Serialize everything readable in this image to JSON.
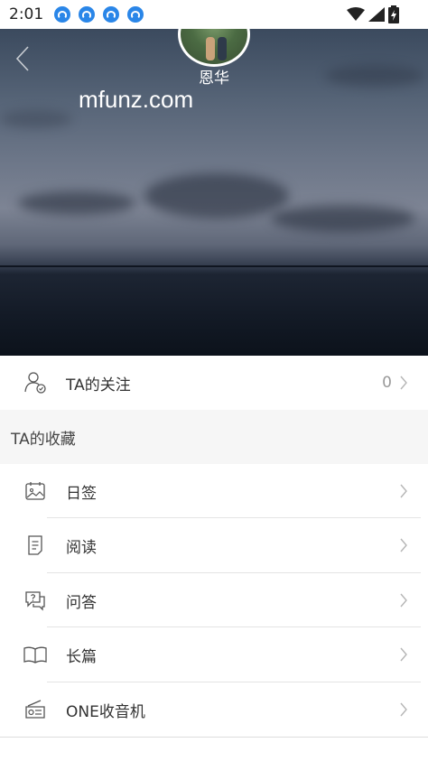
{
  "status_bar": {
    "time": "2:01"
  },
  "profile": {
    "username": "恩华",
    "watermark": "mfunz.com"
  },
  "following": {
    "label": "TA的关注",
    "count": "0"
  },
  "collections": {
    "header": "TA的收藏",
    "items": [
      {
        "label": "日签",
        "icon": "calendar-image-icon"
      },
      {
        "label": "阅读",
        "icon": "document-icon"
      },
      {
        "label": "问答",
        "icon": "question-bubble-icon"
      },
      {
        "label": "长篇",
        "icon": "open-book-icon"
      },
      {
        "label": "ONE收音机",
        "icon": "radio-icon"
      }
    ]
  },
  "colors": {
    "accent": "#2a86e8",
    "divider": "#e4e4e4",
    "section_bg": "#f6f6f6",
    "text": "#333333"
  }
}
